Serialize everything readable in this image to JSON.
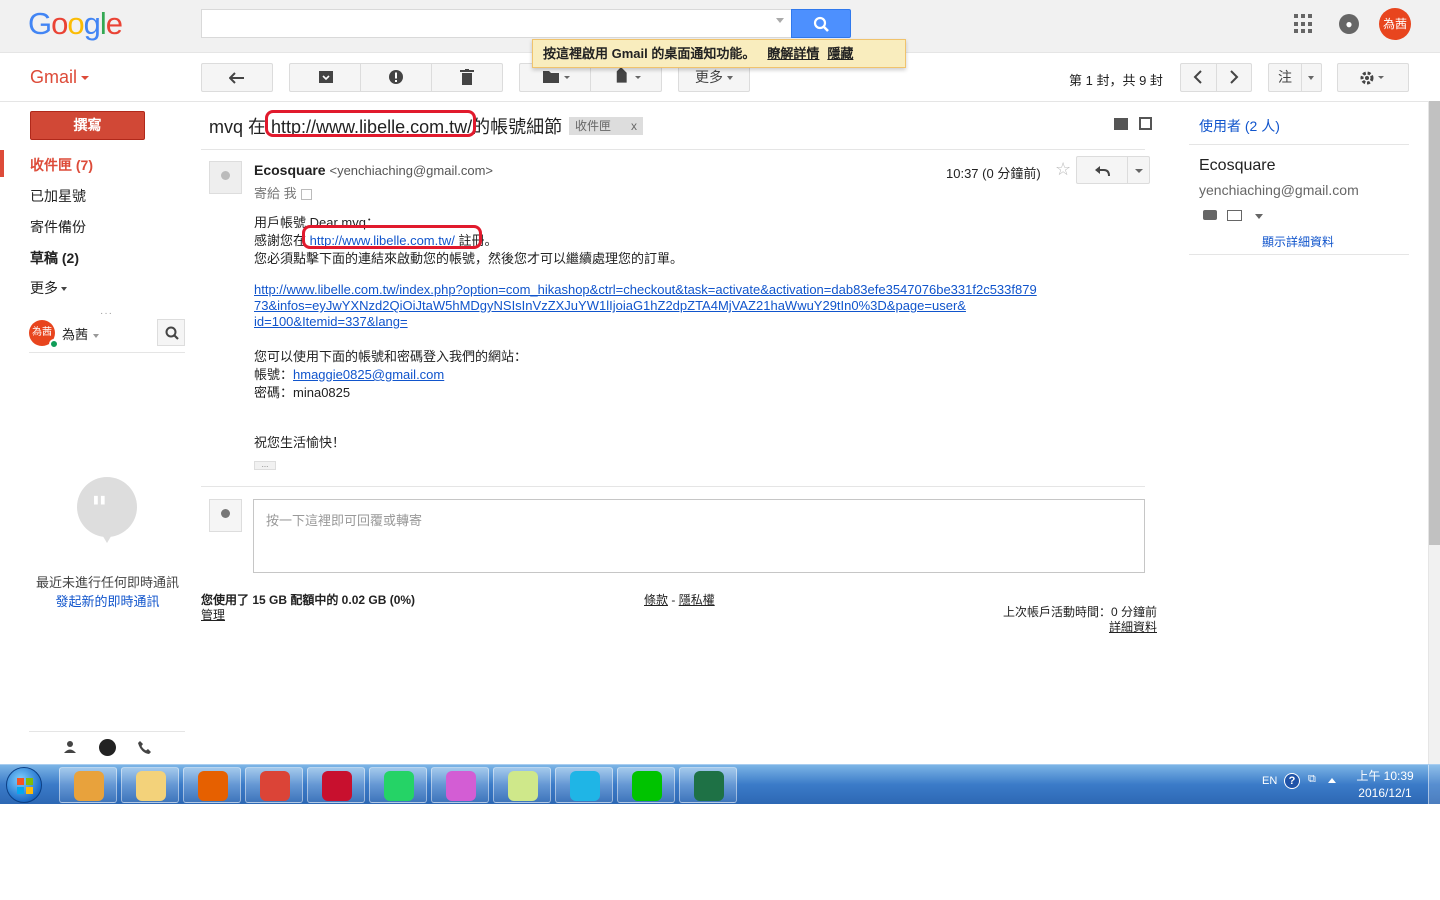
{
  "header": {
    "logo_letters": [
      "G",
      "o",
      "o",
      "g",
      "l",
      "e"
    ],
    "avatar_text": "為茜"
  },
  "notify": {
    "text": "按這裡啟用 Gmail 的桌面通知功能。",
    "learn_more": "瞭解詳情",
    "hide": "隱藏"
  },
  "toolbar": {
    "gmail_label": "Gmail",
    "more_label": "更多",
    "page_count": "第 1 封，共 9 封",
    "input_tools": "注"
  },
  "sidebar": {
    "compose": "撰寫",
    "items": [
      {
        "label": "收件匣 (7)",
        "active": true
      },
      {
        "label": "已加星號"
      },
      {
        "label": "寄件備份"
      },
      {
        "label": "草稿 (2)",
        "bold": true
      },
      {
        "label": "更多"
      }
    ],
    "hangouts_name": "為茜",
    "hangouts_avatar": "為茜",
    "chat_empty": "最近未進行任何即時通訊",
    "chat_start": "發起新的即時通訊"
  },
  "message": {
    "subject_prefix": "mvq 在",
    "subject_url": "http://www.libelle.com.tw/",
    "subject_suffix": "的帳號細節",
    "label_chip": "收件匣",
    "label_close": "x",
    "sender_name": "Ecosquare",
    "sender_email": "<yenchiaching@gmail.com>",
    "to_me": "寄給 我",
    "time": "10:37 (0 分鐘前)",
    "body": {
      "line1": "用戶帳號 Dear mvq：",
      "line2_prefix": "感謝您在",
      "line2_link": "http://www.libelle.com.tw/",
      "line2_suffix": "註冊。",
      "line3": "您必須點擊下面的連結來啟動您的帳號，然後您才可以繼續處理您的訂單。",
      "activation_link_1": "http://www.libelle.com.tw/index.php?option=com_hikashop&ctrl=checkout&task=activate&activation=dab83efe3547076be331f2c533f879",
      "activation_link_2": "73&infos=eyJwYXNzd2QiOiJtaW5hMDgyNSIsInVzZXJuYW1lIjoiaG1hZ2dpZTA4MjVAZ21haWwuY29tIn0%3D&page=user&",
      "activation_link_3": "id=100&Itemid=337&lang=",
      "line5": "您可以使用下面的帳號和密碼登入我們的網站：",
      "account_label": "帳號：",
      "account_value": "hmaggie0825@gmail.com",
      "password_label": "密碼：",
      "password_value": "mina0825",
      "closing": "祝您生活愉快！",
      "ellipsis": "..."
    },
    "reply_placeholder": "按一下這裡即可回覆或轉寄"
  },
  "footer": {
    "quota": "您使用了 15 GB 配額中的 0.02 GB (0%)",
    "manage": "管理",
    "terms": "條款",
    "dash": " - ",
    "privacy": "隱私權",
    "last_activity": "上次帳戶活動時間：0 分鐘前",
    "details": "詳細資料"
  },
  "right_panel": {
    "people": "使用者 (2 人)",
    "name": "Ecosquare",
    "email": "yenchiaching@gmail.com",
    "show_details": "顯示詳細資料"
  },
  "taskbar": {
    "lang": "EN",
    "help": "?",
    "time": "上午 10:39",
    "date": "2016/12/1",
    "apps": [
      {
        "name": "control-panel",
        "color": "#e8a23c"
      },
      {
        "name": "file-explorer",
        "color": "#f3d27a"
      },
      {
        "name": "firefox",
        "color": "#e66000"
      },
      {
        "name": "chrome",
        "color": "#db4437"
      },
      {
        "name": "duke",
        "color": "#c8102e"
      },
      {
        "name": "whatsapp",
        "color": "#25d366"
      },
      {
        "name": "itunes",
        "color": "#d35dd4"
      },
      {
        "name": "sticky-notes",
        "color": "#cfe88a"
      },
      {
        "name": "kkbox",
        "color": "#1fb5e6"
      },
      {
        "name": "line",
        "color": "#00c300"
      },
      {
        "name": "excel",
        "color": "#1e7145"
      }
    ]
  },
  "colors": {
    "accent_red": "#dd4b39",
    "link_blue": "#1155cc",
    "highlight_ring": "#e11a2d"
  }
}
